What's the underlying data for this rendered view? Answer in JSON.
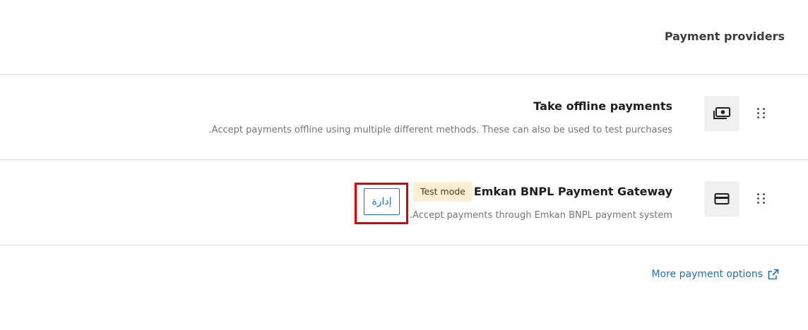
{
  "header": {
    "title": "Payment providers"
  },
  "providers": [
    {
      "title": "Take offline payments",
      "description": ".Accept payments offline using multiple different methods. These can also be used to test purchases",
      "icon": "cash-icon"
    },
    {
      "title": "Emkan BNPL Payment Gateway",
      "description": ".Accept payments through Emkan BNPL payment system",
      "icon": "card-icon",
      "badge": "Test mode",
      "manage_label": "إدارة"
    }
  ],
  "footer": {
    "more_link": "More payment options",
    "link_icon": "external-link-icon"
  },
  "colors": {
    "accent": "#2271b1",
    "highlight": "#e00000",
    "badge_bg": "#fcefd4"
  }
}
